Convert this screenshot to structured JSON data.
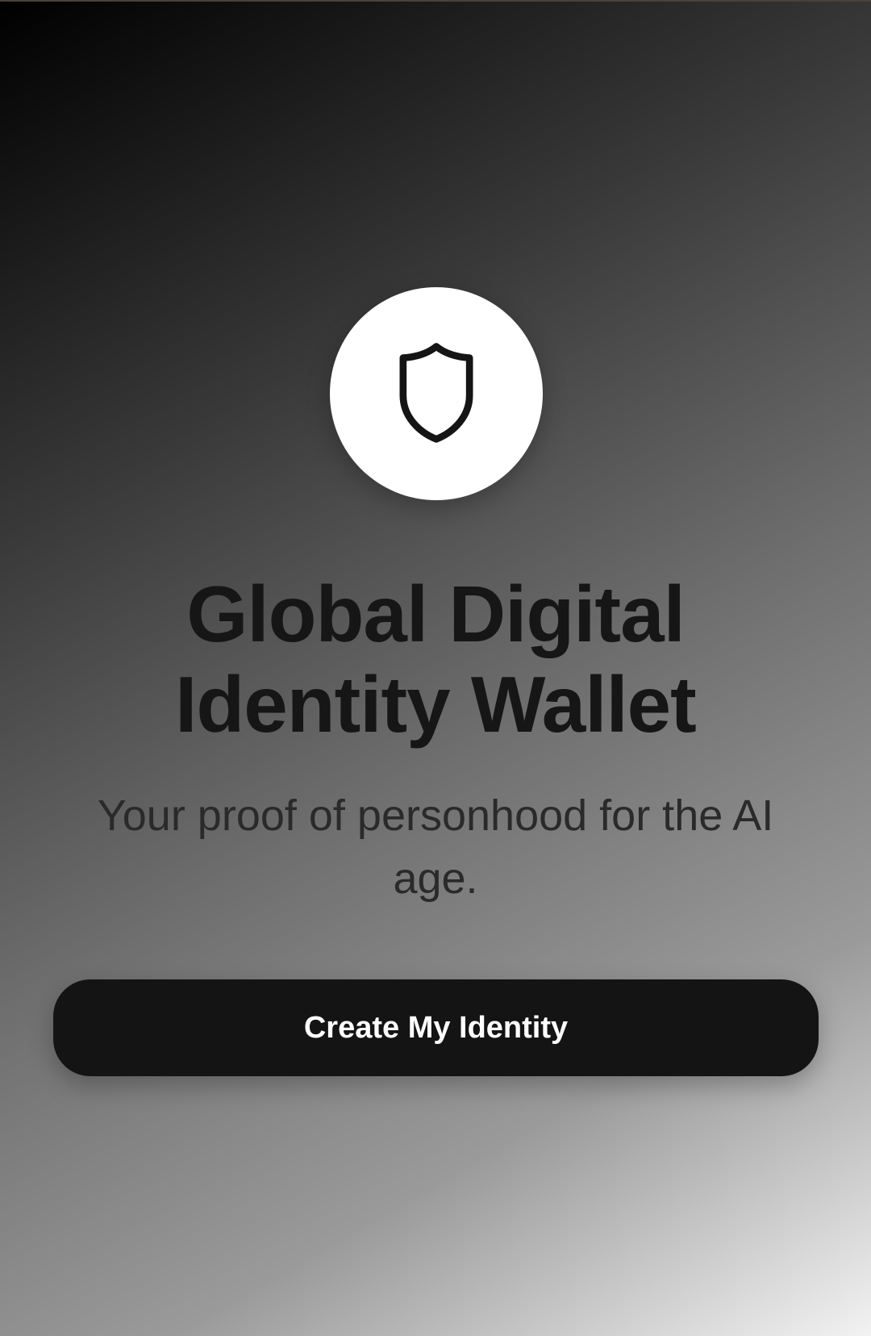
{
  "welcome": {
    "logo_icon": "shield-icon",
    "title": "Global Digital Identity Wallet",
    "subtitle": "Your proof of personhood for the AI age.",
    "cta_label": "Create My Identity"
  },
  "colors": {
    "background_start": "#000000",
    "background_end": "#f2f2f2",
    "button_bg": "#141414",
    "button_text": "#ffffff",
    "logo_bg": "#ffffff",
    "title_text": "#161616"
  }
}
